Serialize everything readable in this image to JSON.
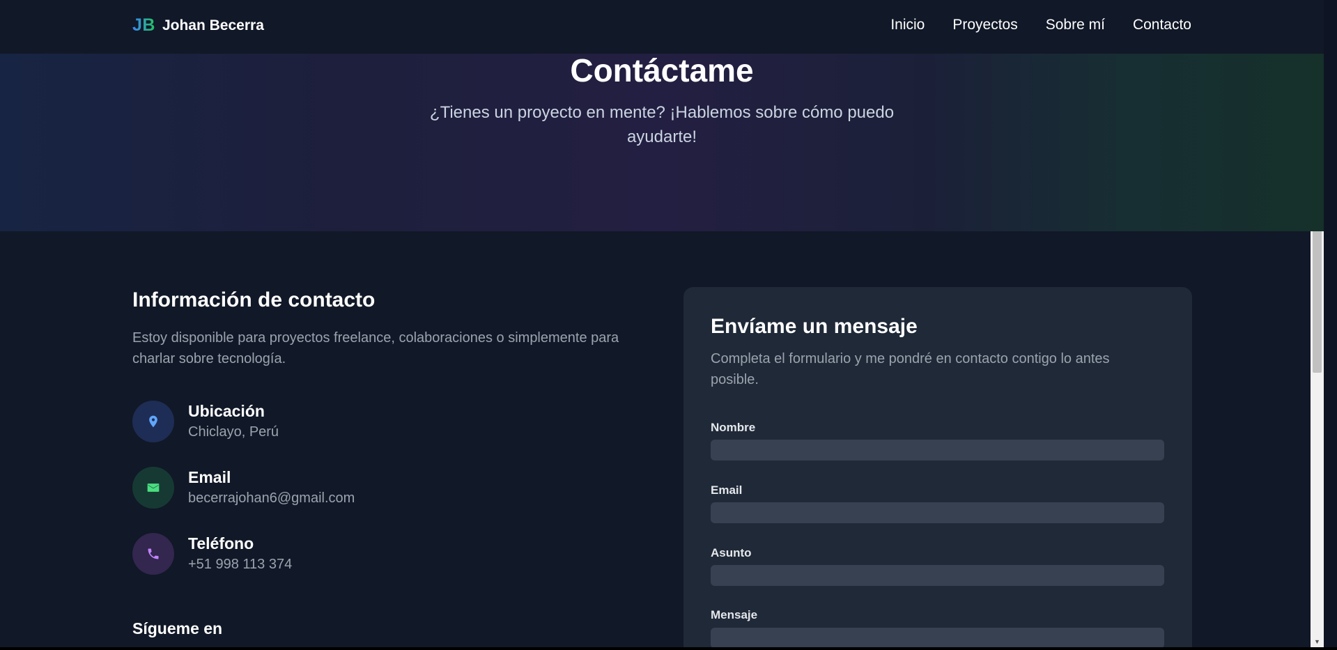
{
  "brand": {
    "initials": "JB",
    "name": "Johan Becerra"
  },
  "nav": {
    "links": [
      "Inicio",
      "Proyectos",
      "Sobre mí",
      "Contacto"
    ]
  },
  "hero": {
    "title": "Contáctame",
    "subtitle": "¿Tienes un proyecto en mente? ¡Hablemos sobre cómo puedo ayudarte!"
  },
  "contact_info": {
    "title": "Información de contacto",
    "description": "Estoy disponible para proyectos freelance, colaboraciones o simplemente para charlar sobre tecnología.",
    "items": [
      {
        "label": "Ubicación",
        "value": "Chiclayo, Perú",
        "icon": "map-pin-icon",
        "color": "#60a5fa",
        "bg": "#1e2d55"
      },
      {
        "label": "Email",
        "value": "becerrajohan6@gmail.com",
        "icon": "mail-icon",
        "color": "#4ade80",
        "bg": "#163a33"
      },
      {
        "label": "Teléfono",
        "value": "+51 998 113 374",
        "icon": "phone-icon",
        "color": "#c084fc",
        "bg": "#33264f"
      }
    ],
    "follow_label": "Sígueme en"
  },
  "form": {
    "title": "Envíame un mensaje",
    "description": "Completa el formulario y me pondré en contacto contigo lo antes posible.",
    "fields": [
      {
        "label": "Nombre",
        "value": ""
      },
      {
        "label": "Email",
        "value": ""
      },
      {
        "label": "Asunto",
        "value": ""
      },
      {
        "label": "Mensaje",
        "value": ""
      }
    ]
  },
  "colors": {
    "background": "#111827",
    "card": "#1f2937",
    "input": "#374151",
    "brand_gradient_start": "#3b82f6",
    "brand_gradient_end": "#22c55e"
  }
}
